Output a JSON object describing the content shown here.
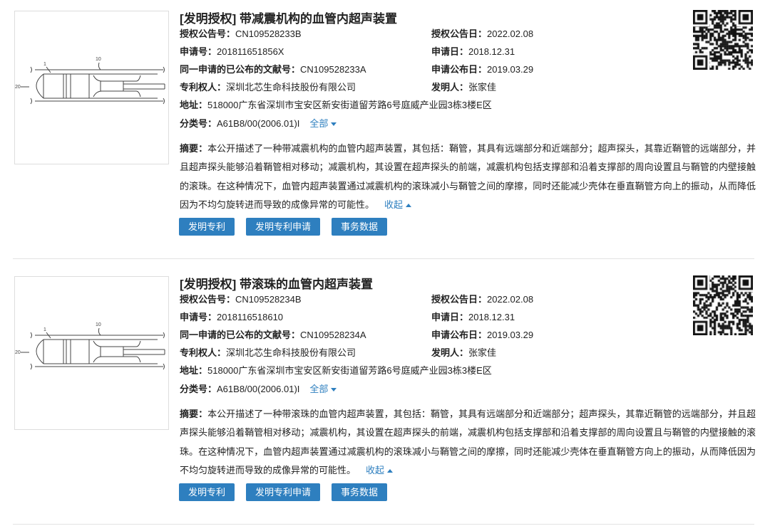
{
  "colors": {
    "accent": "#2e7fbf"
  },
  "common": {
    "grant_no_label": "授权公告号：",
    "grant_date_label": "授权公告日：",
    "app_no_label": "申请号：",
    "app_date_label": "申请日：",
    "same_app_label": "同一申请的已公布的文献号：",
    "pub_date_label": "申请公布日：",
    "patentee_label": "专利权人：",
    "inventor_label": "发明人：",
    "address_label": "地址：",
    "class_label": "分类号：",
    "all_label": "全部",
    "abstract_label": "摘要：",
    "collapse_label": "收起",
    "buttons": [
      "发明专利",
      "发明专利申请",
      "事务数据"
    ]
  },
  "results": [
    {
      "title": "[发明授权] 带减震机构的血管内超声装置",
      "grant_no": "CN109528233B",
      "grant_date": "2022.02.08",
      "app_no": "201811651856X",
      "app_date": "2018.12.31",
      "same_app": "CN109528233A",
      "pub_date": "2019.03.29",
      "patentee": "深圳北芯生命科技股份有限公司",
      "inventor": "张家佳",
      "address": "518000广东省深圳市宝安区新安街道留芳路6号庭威产业园3栋3楼E区",
      "class": "A61B8/00(2006.01)I",
      "abstract": "本公开描述了一种带减震机构的血管内超声装置，其包括：鞘管，其具有远端部分和近端部分；超声探头，其靠近鞘管的远端部分，并且超声探头能够沿着鞘管相对移动；减震机构，其设置在超声探头的前端，减震机构包括支撑部和沿着支撑部的周向设置且与鞘管的内壁接触的滚珠。在这种情况下，血管内超声装置通过减震机构的滚珠减小与鞘管之间的摩擦，同时还能减少壳体在垂直鞘管方向上的振动，从而降低因为不均匀旋转进而导致的成像异常的可能性。",
      "fig_labels": [
        "1",
        "10",
        "20"
      ]
    },
    {
      "title": "[发明授权] 带滚珠的血管内超声装置",
      "grant_no": "CN109528234B",
      "grant_date": "2022.02.08",
      "app_no": "2018116518610",
      "app_date": "2018.12.31",
      "same_app": "CN109528234A",
      "pub_date": "2019.03.29",
      "patentee": "深圳北芯生命科技股份有限公司",
      "inventor": "张家佳",
      "address": "518000广东省深圳市宝安区新安街道留芳路6号庭威产业园3栋3楼E区",
      "class": "A61B8/00(2006.01)I",
      "abstract": "本公开描述了一种带滚珠的血管内超声装置，其包括：鞘管，其具有远端部分和近端部分；超声探头，其靠近鞘管的远端部分，并且超声探头能够沿着鞘管相对移动；减震机构，其设置在超声探头的前端，减震机构包括支撑部和沿着支撑部的周向设置且与鞘管的内壁接触的滚珠。在这种情况下，血管内超声装置通过减震机构的滚珠减小与鞘管之间的摩擦，同时还能减少壳体在垂直鞘管方向上的振动，从而降低因为不均匀旋转进而导致的成像异常的可能性。",
      "fig_labels": [
        "1",
        "10",
        "20"
      ]
    }
  ]
}
